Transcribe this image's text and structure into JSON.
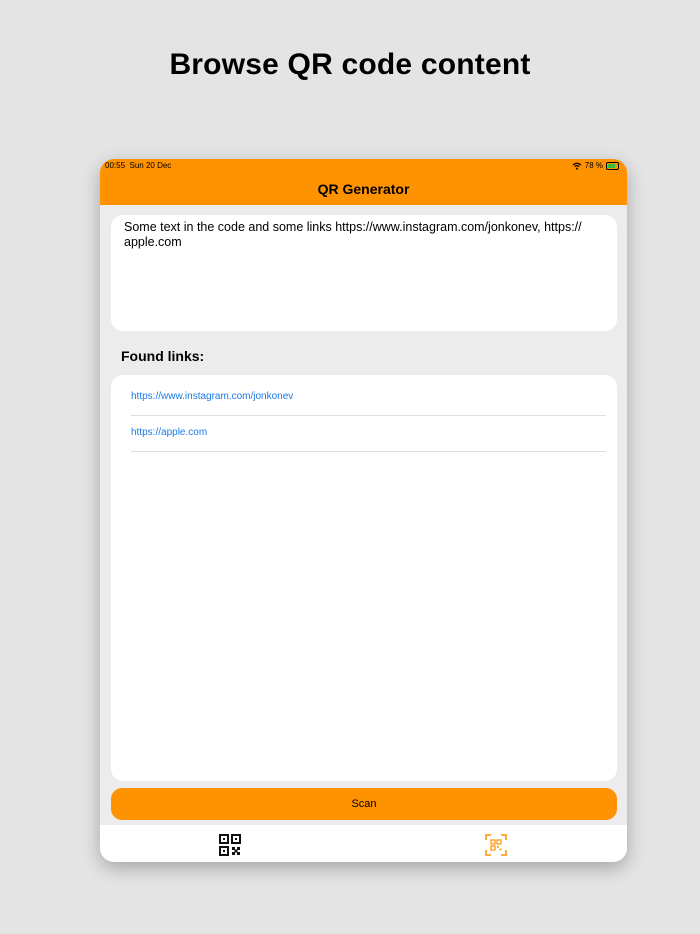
{
  "headline": "Browse QR code content",
  "status_bar": {
    "time": "00:55",
    "date": "Sun 20 Dec",
    "battery": "78 %"
  },
  "nav": {
    "title": "QR Generator"
  },
  "code_text": "Some text in the code and some links https://www.instagram.com/jonkonev, https://apple.com",
  "code_text_line1": "Some text in the code and some links https://www.instagram.com/jonkonev, https://",
  "code_text_line2": "apple.com",
  "found_links": {
    "title": "Found links:",
    "items": [
      {
        "label": "https://www.instagram.com/jonkonev"
      },
      {
        "label": "https://apple.com"
      }
    ]
  },
  "scan_button": {
    "label": "Scan"
  },
  "tabs": [
    {
      "icon": "qr-code-icon",
      "active": false
    },
    {
      "icon": "qr-scan-icon",
      "active": true
    }
  ],
  "colors": {
    "accent": "#ff9200",
    "link": "#1a7ae6",
    "background": "#e4e4e4",
    "panel": "#ececec"
  }
}
